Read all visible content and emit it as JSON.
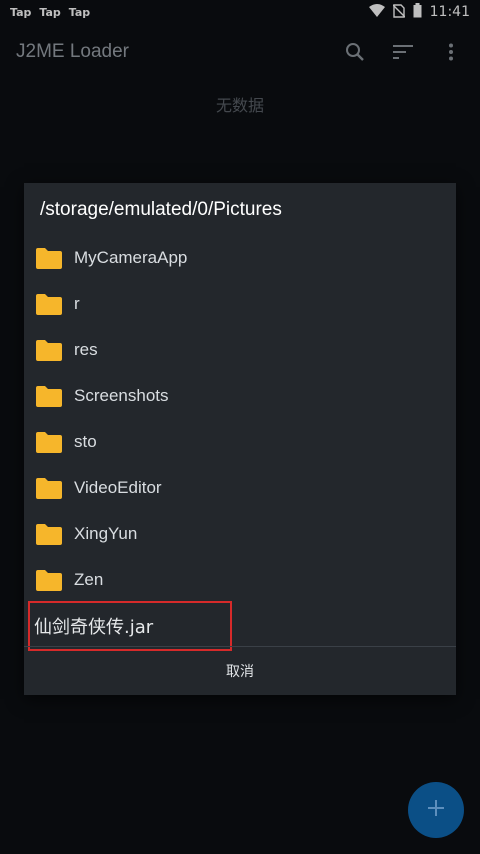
{
  "status": {
    "notifications": [
      "Tap",
      "Tap",
      "Tap"
    ],
    "time": "11:41"
  },
  "app_bar": {
    "title": "J2ME Loader"
  },
  "main": {
    "empty_text": "无数据"
  },
  "dialog": {
    "path": "/storage/emulated/0/Pictures",
    "folders": [
      "MyCameraApp",
      "r",
      "res",
      "Screenshots",
      "sto",
      "VideoEditor",
      "XingYun",
      "Zen"
    ],
    "file": "仙剑奇侠传.jar",
    "cancel_label": "取消"
  },
  "colors": {
    "folder": "#f6b62b",
    "highlight": "#d62a2a",
    "fab": "#0b4f86"
  }
}
